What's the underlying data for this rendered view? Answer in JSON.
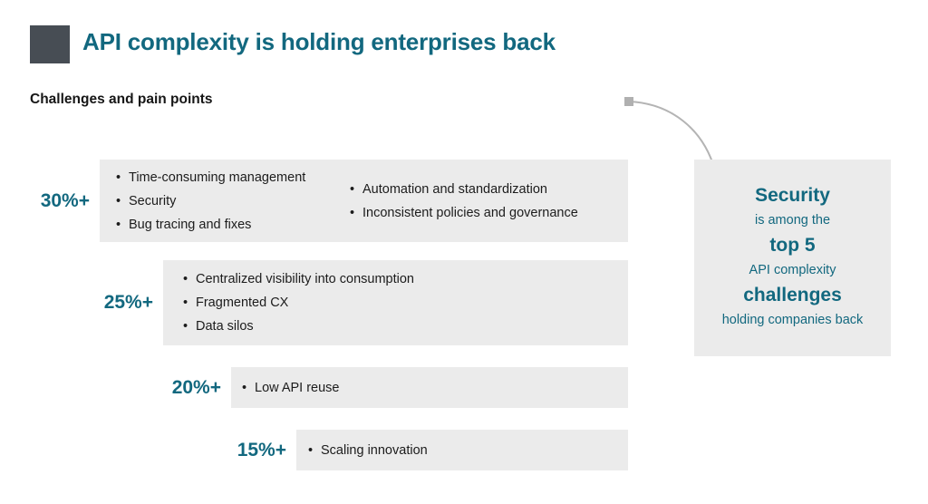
{
  "header": {
    "logo_mark": "dark-square-logo",
    "title": "API complexity is holding enterprises back",
    "section_label": "Challenges and pain points",
    "title_color": "#12687f",
    "logo_color": "#474d54"
  },
  "chart_data": {
    "type": "bar",
    "title": "Challenges and pain points",
    "orientation": "horizontal",
    "categories": [
      "30%+",
      "25%+",
      "20%+",
      "15%+"
    ],
    "values": [
      30,
      25,
      20,
      15
    ],
    "value_suffix": "%+",
    "xlabel": "",
    "ylabel": "",
    "grid": false,
    "legend": false,
    "bar_color": "#ebebeb",
    "label_color": "#12687f",
    "bars": [
      {
        "percent": "30%+",
        "value": 30,
        "columns": [
          [
            "Time-consuming management",
            "Security",
            "Bug tracing and fixes"
          ],
          [
            "Automation and standardization",
            "Inconsistent policies and governance"
          ]
        ]
      },
      {
        "percent": "25%+",
        "value": 25,
        "columns": [
          [
            "Centralized visibility into consumption",
            "Fragmented CX",
            "Data silos"
          ]
        ]
      },
      {
        "percent": "20%+",
        "value": 20,
        "columns": [
          [
            "Low API reuse"
          ]
        ]
      },
      {
        "percent": "15%+",
        "value": 15,
        "columns": [
          [
            "Scaling innovation"
          ]
        ]
      }
    ]
  },
  "callout": {
    "lines": [
      {
        "text": "Security",
        "emphasis": "large"
      },
      {
        "text": "is among the",
        "emphasis": "small"
      },
      {
        "text": "top 5",
        "emphasis": "large"
      },
      {
        "text": "API complexity",
        "emphasis": "small"
      },
      {
        "text": "challenges",
        "emphasis": "large"
      },
      {
        "text": "holding companies back",
        "emphasis": "small"
      }
    ],
    "background": "#ebebeb",
    "text_color": "#12687f"
  },
  "connector": {
    "node_shape": "square",
    "node_color": "#b0b0b0",
    "line_color": "#b4b4b4"
  }
}
